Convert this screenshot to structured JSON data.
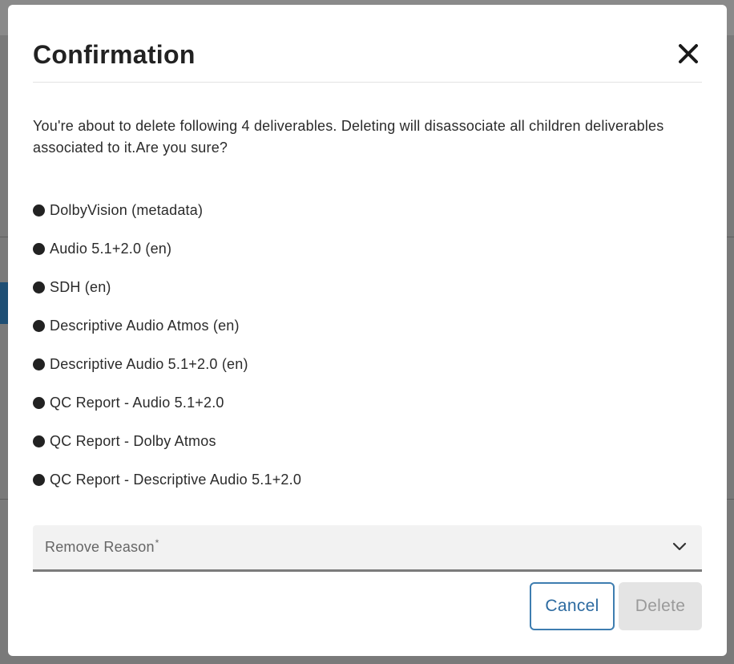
{
  "dialog": {
    "title": "Confirmation",
    "message": "You're about to delete following 4 deliverables. Deleting will disassociate all children deliverables associated to it.Are you sure?",
    "items": [
      "DolbyVision (metadata)",
      "Audio 5.1+2.0 (en)",
      "SDH (en)",
      "Descriptive Audio Atmos (en)",
      "Descriptive Audio 5.1+2.0 (en)",
      "QC Report - Audio 5.1+2.0",
      "QC Report - Dolby Atmos",
      "QC Report - Descriptive Audio 5.1+2.0"
    ],
    "reason_select": {
      "label": "Remove Reason",
      "required_mark": "*"
    },
    "buttons": {
      "cancel": "Cancel",
      "delete": "Delete"
    }
  },
  "icons": {
    "close": "close-icon",
    "dropdown": "chevron-down-icon",
    "bullet": "bullet-icon"
  },
  "colors": {
    "primary": "#2c6aa0",
    "text": "#222222",
    "disabled_bg": "#e4e4e4",
    "disabled_text": "#9a9a9a"
  }
}
